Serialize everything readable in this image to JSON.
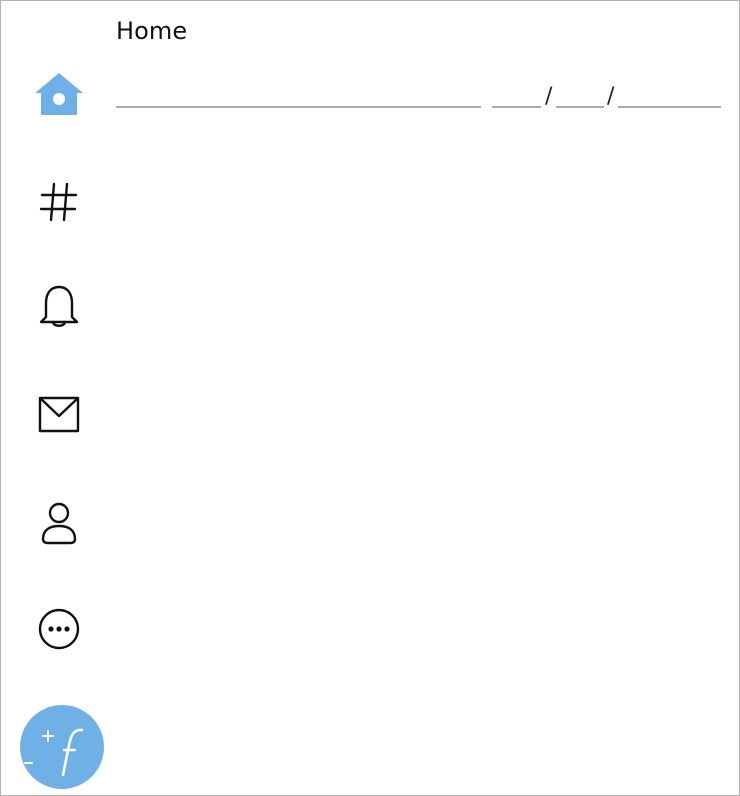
{
  "header": {
    "title": "Home",
    "date_separators": [
      "/",
      "/"
    ]
  },
  "sidebar": {
    "items": [
      {
        "name": "home",
        "icon": "home-icon",
        "active": true
      },
      {
        "name": "explore",
        "icon": "hashtag-icon",
        "active": false
      },
      {
        "name": "notifications",
        "icon": "bell-icon",
        "active": false
      },
      {
        "name": "messages",
        "icon": "mail-icon",
        "active": false
      },
      {
        "name": "profile",
        "icon": "person-icon",
        "active": false
      },
      {
        "name": "more",
        "icon": "more-icon",
        "active": false
      }
    ]
  },
  "fab": {
    "icon": "compose-icon"
  },
  "colors": {
    "accent": "#6fb1e6",
    "icon": "#111111",
    "line": "#a9a9a9",
    "border": "#b4b4b4"
  }
}
